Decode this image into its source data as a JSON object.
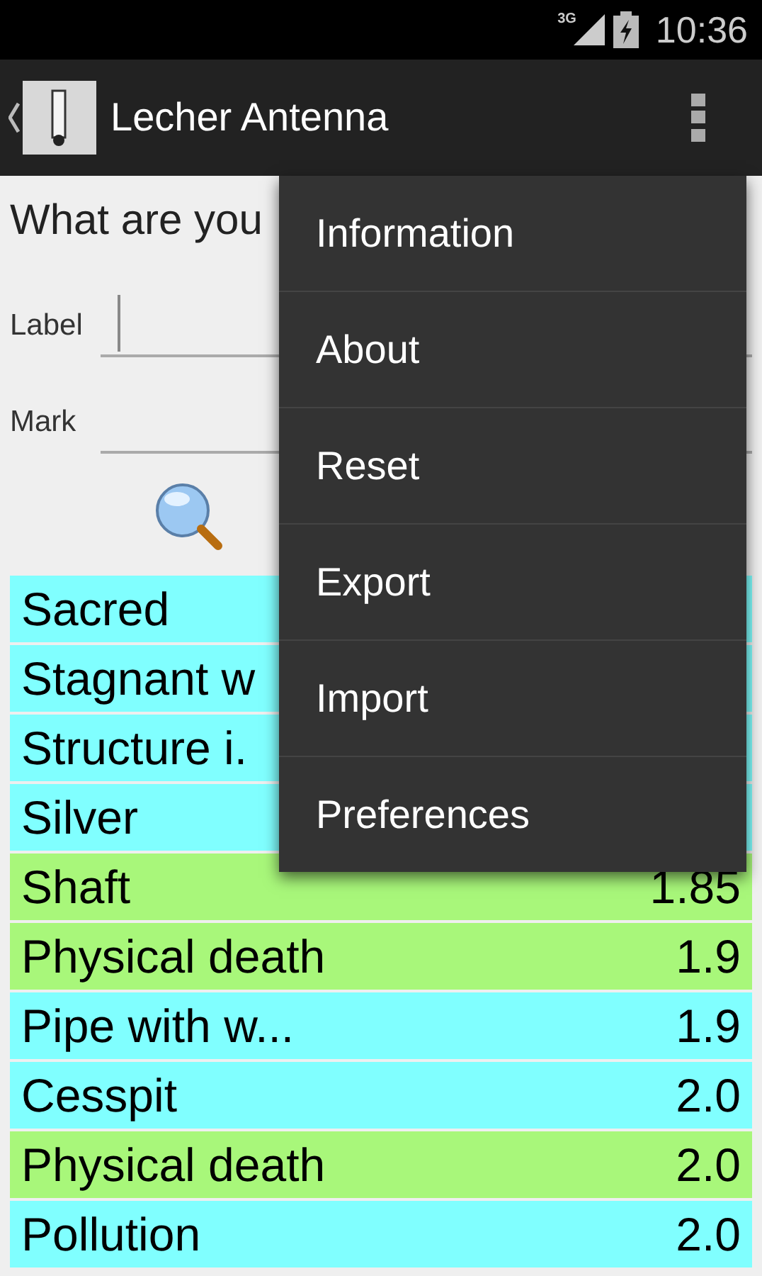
{
  "status_bar": {
    "network": "3G",
    "time": "10:36"
  },
  "action_bar": {
    "title": "Lecher Antenna"
  },
  "form": {
    "question": "What are you",
    "fields": [
      {
        "label": "Label",
        "focused": true
      },
      {
        "label": "Mark",
        "focused": false
      }
    ]
  },
  "rows": [
    {
      "name": "Sacred",
      "color": "#80ffff"
    },
    {
      "name": "Stagnant w",
      "color": "#80ffff"
    },
    {
      "name": "Structure i.",
      "color": "#80ffff"
    },
    {
      "name": "Silver",
      "color": "#80ffff"
    },
    {
      "name": "Shaft",
      "value": "1.85",
      "color": "#a8f77a"
    },
    {
      "name": "Physical death",
      "value": "1.9",
      "color": "#a8f77a"
    },
    {
      "name": "Pipe with w...",
      "value": "1.9",
      "color": "#80ffff"
    },
    {
      "name": "Cesspit",
      "value": "2.0",
      "color": "#80ffff"
    },
    {
      "name": "Physical death",
      "value": "2.0",
      "color": "#a8f77a"
    },
    {
      "name": "Pollution",
      "value": "2.0",
      "color": "#80ffff"
    }
  ],
  "menu": [
    "Information",
    "About",
    "Reset",
    "Export",
    "Import",
    "Preferences"
  ]
}
